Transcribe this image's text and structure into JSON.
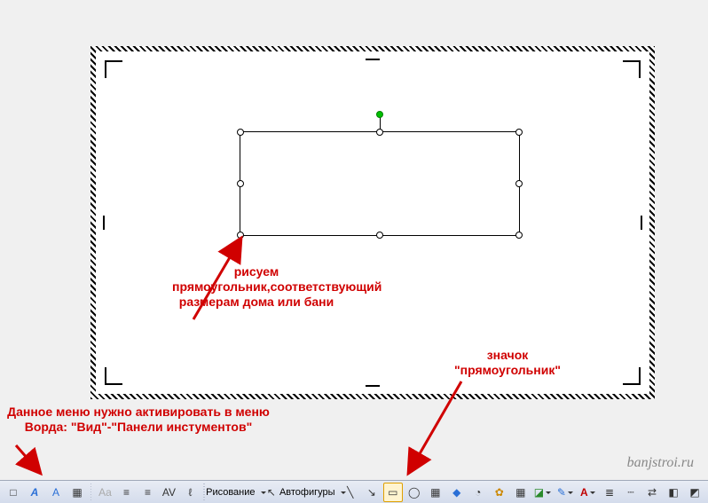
{
  "annotations": {
    "rect_note": "рисуем прямоугольник,соответствующий размерам дома или бани",
    "icon_note": "значок \"прямоугольник\"",
    "menu_note": "Данное меню нужно активировать в меню Ворда: \"Вид\"-\"Панели инстументов\""
  },
  "watermark": "banjstroi.ru",
  "toolbar": {
    "draw_label": "Рисование",
    "autoshapes_label": "Автофигуры"
  },
  "icons": {
    "textbox": "A",
    "wordart": "A",
    "insert": "□",
    "align_left": "≡",
    "align_center": "≡",
    "av": "AV",
    "pointer": "↖",
    "line": "╲",
    "arrowline": "↘",
    "rect": "▭",
    "oval": "◯",
    "pict": "▦",
    "clipart": "✿",
    "fill": "◪",
    "linecolor": "✎",
    "fontcolor": "A",
    "lineweight": "≣",
    "dash": "┄",
    "arrowstyle": "⇄",
    "shadow": "◧",
    "threed": "◩",
    "diagram": "◆",
    "chart": "◔"
  }
}
